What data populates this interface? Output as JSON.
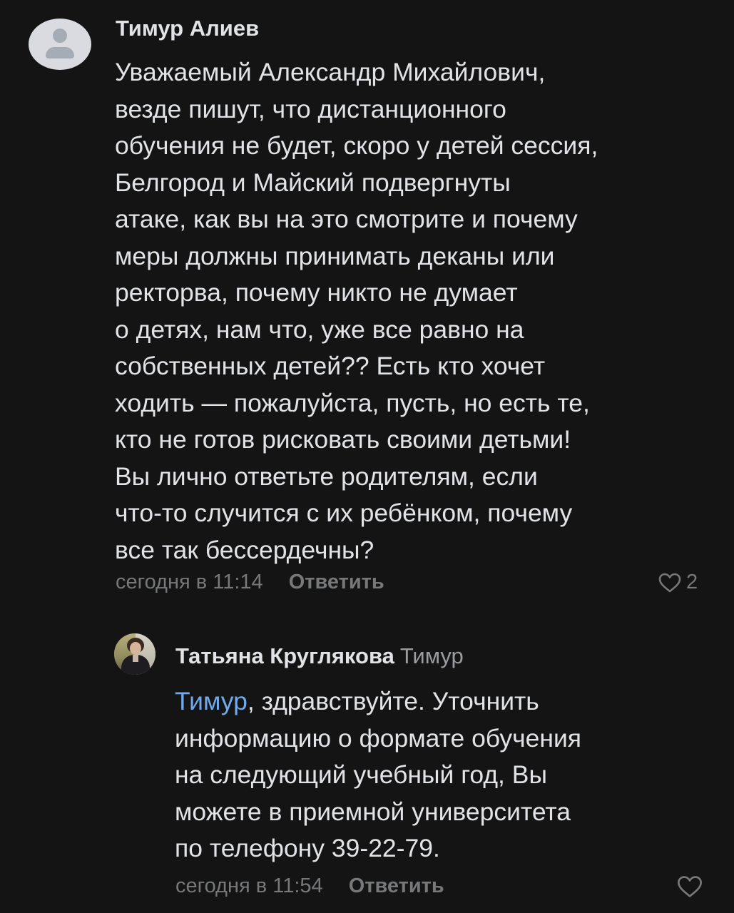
{
  "comments": [
    {
      "author": "Тимур Алиев",
      "text_lines": [
        "Уважаемый Александр Михайлович,",
        "везде пишут, что дистанционного",
        "обучения не будет, скоро у детей сессия,",
        "Белгород и Майский подвергнуты",
        "атаке, как вы на это смотрите и почему",
        "меры должны принимать деканы или",
        "ректорва, почему никто не думает",
        "о детях, нам что, уже все равно на",
        "собственных детей?? Есть кто хочет",
        "ходить — пожалуйста, пусть, но есть те,",
        "кто не готов рисковать своими детьми!",
        "Вы лично ответьте родителям, если",
        "что-то случится с их ребёнком, почему",
        "все так бессердечны?"
      ],
      "time": "сегодня в 11:14",
      "reply_label": "Ответить",
      "likes": "2"
    },
    {
      "author": "Татьяна Круглякова",
      "reply_to": "Тимур",
      "mention": "Тимур",
      "first_line_rest": ", здравствуйте. Уточнить",
      "text_lines": [
        "информацию о формате обучения",
        "на следующий учебный год, Вы",
        "можете в приемной университета",
        "по телефону 39-22-79."
      ],
      "time": "сегодня в 11:54",
      "reply_label": "Ответить"
    }
  ],
  "icons": {
    "avatar_placeholder": "user-placeholder-icon",
    "like": "heart-outline-icon"
  },
  "colors": {
    "background": "#141414",
    "text": "#e1e3e6",
    "secondary": "#76787a",
    "mention": "#71aaeb"
  }
}
